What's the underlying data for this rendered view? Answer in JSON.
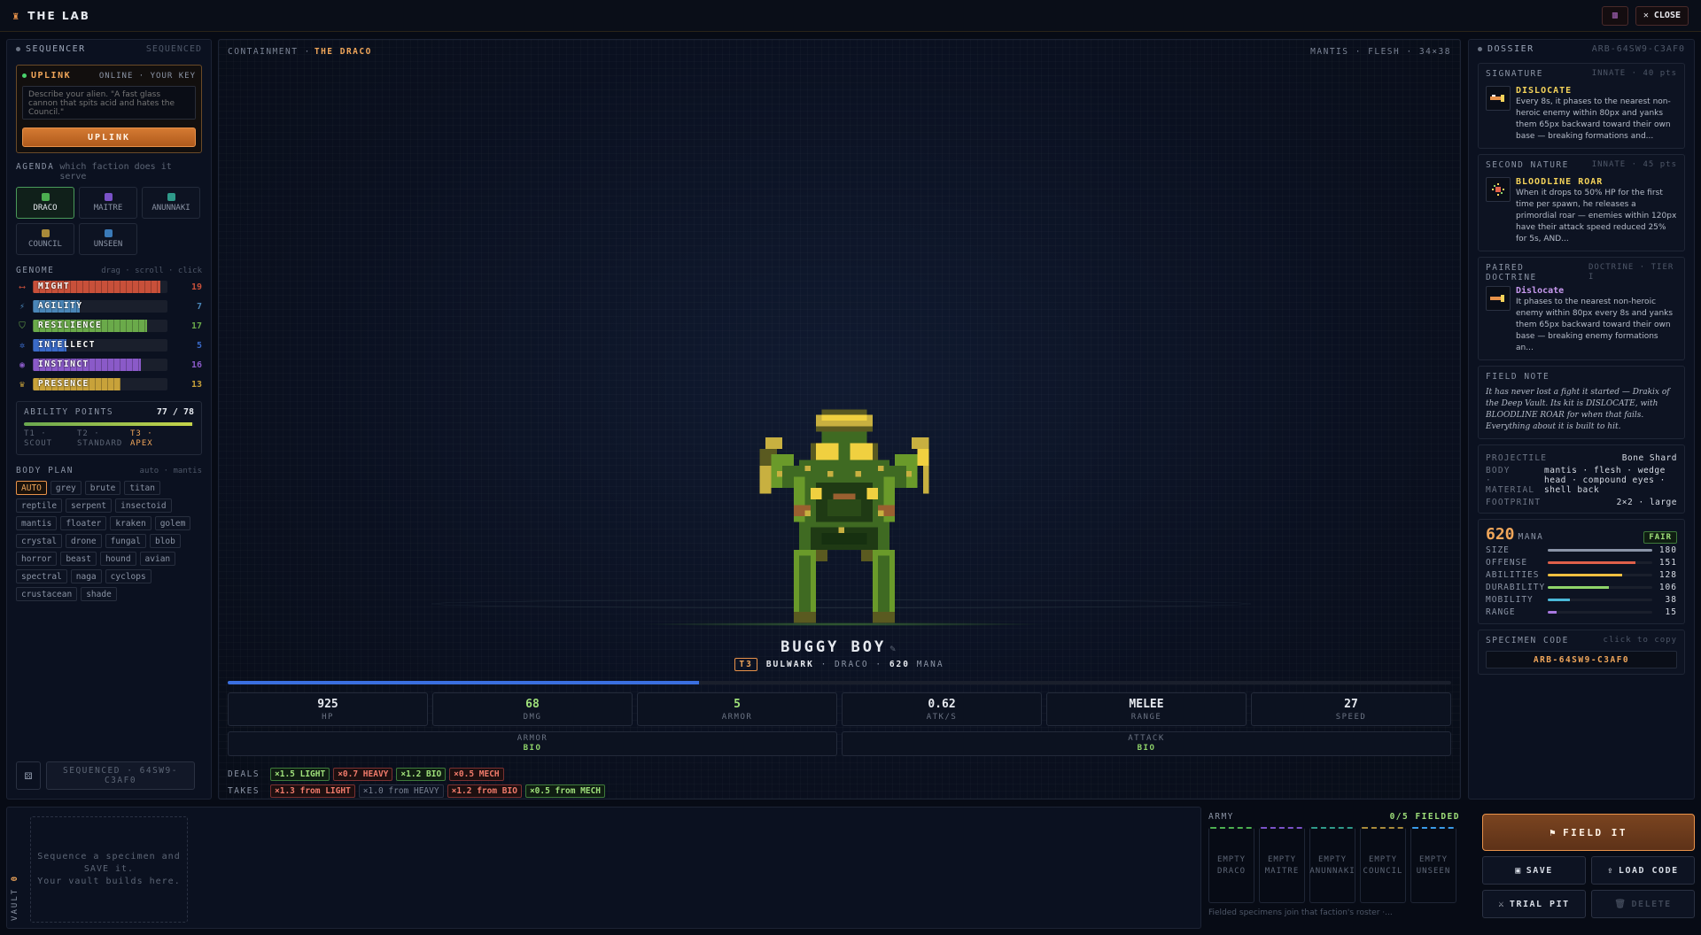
{
  "topbar": {
    "title": "THE LAB",
    "close_label": "✕ CLOSE"
  },
  "sequencer": {
    "title": "SEQUENCER",
    "status": "SEQUENCED",
    "uplink": {
      "title": "UPLINK",
      "status": "ONLINE · YOUR KEY",
      "placeholder": "Describe your alien. \"A fast glass cannon that spits acid and hates the Council.\"",
      "button": "UPLINK"
    },
    "agenda": {
      "label": "AGENDA",
      "hint": "which faction does it serve",
      "factions": [
        {
          "name": "DRACO",
          "color": "#4caf50",
          "selected": true
        },
        {
          "name": "MAITRE",
          "color": "#7a52c8"
        },
        {
          "name": "ANUNNAKI",
          "color": "#2f9a8a"
        },
        {
          "name": "COUNCIL",
          "color": "#a88a3a"
        },
        {
          "name": "UNSEEN",
          "color": "#3a7ab8"
        }
      ]
    },
    "genome": {
      "label": "GENOME",
      "hint": "drag · scroll · click",
      "stats": [
        {
          "name": "MIGHT",
          "value": 19,
          "max": 20,
          "color": "#c8503a",
          "icon": "⟷"
        },
        {
          "name": "AGILITY",
          "value": 7,
          "max": 20,
          "color": "#4a86b8",
          "icon": "⚡"
        },
        {
          "name": "RESILIENCE",
          "value": 17,
          "max": 20,
          "color": "#6aaa4a",
          "icon": "⛉"
        },
        {
          "name": "INTELLECT",
          "value": 5,
          "max": 20,
          "color": "#3a6ac8",
          "icon": "✲"
        },
        {
          "name": "INSTINCT",
          "value": 16,
          "max": 20,
          "color": "#8a5ac8",
          "icon": "◉"
        },
        {
          "name": "PRESENCE",
          "value": 13,
          "max": 20,
          "color": "#c8a23a",
          "icon": "♛"
        }
      ]
    },
    "ability_points": {
      "label": "ABILITY POINTS",
      "value": "77 / 78",
      "fraction": 0.987,
      "tiers": [
        {
          "a": "T1 ·",
          "b": "SCOUT"
        },
        {
          "a": "T2 ·",
          "b": "STANDARD"
        },
        {
          "a": "T3 ·",
          "b": "APEX",
          "active": true
        }
      ]
    },
    "body_plan": {
      "label": "BODY PLAN",
      "hint": "auto · mantis",
      "options": [
        "AUTO",
        "grey",
        "brute",
        "titan",
        "reptile",
        "serpent",
        "insectoid",
        "mantis",
        "floater",
        "kraken",
        "golem",
        "crystal",
        "drone",
        "fungal",
        "blob",
        "horror",
        "beast",
        "hound",
        "avian",
        "spectral",
        "naga",
        "cyclops",
        "crustacean",
        "shade"
      ]
    },
    "sequenced_label": "SEQUENCED · 64SW9-C3AF0"
  },
  "center": {
    "containment": "CONTAINMENT ·",
    "faction": "THE DRACO",
    "meta_right": "MANTIS · FLESH · 34×38",
    "name": "BUGGY BOY",
    "edit_icon": "✎",
    "tier": "T3",
    "class": "BULWARK",
    "faction_name": "DRACO",
    "mana": "620",
    "mana_unit": "MANA",
    "hp_fraction": 0.385,
    "stats": [
      {
        "value": "925",
        "label": "HP",
        "color": "#e6e9ef"
      },
      {
        "value": "68",
        "label": "DMG",
        "color": "#9fe07a"
      },
      {
        "value": "5",
        "label": "ARMOR",
        "color": "#9fe07a"
      },
      {
        "value": "0.62",
        "label": "ATK/S",
        "color": "#e6e9ef"
      },
      {
        "value": "MELEE",
        "label": "RANGE",
        "color": "#e6e9ef"
      },
      {
        "value": "27",
        "label": "SPEED",
        "color": "#e6e9ef"
      }
    ],
    "armor": {
      "label": "ARMOR",
      "value": "BIO"
    },
    "attack": {
      "label": "ATTACK",
      "value": "BIO"
    },
    "deals": {
      "label": "DEALS",
      "mods": [
        {
          "text": "×1.5 LIGHT",
          "kind": "good"
        },
        {
          "text": "×0.7 HEAVY",
          "kind": "bad"
        },
        {
          "text": "×1.2 BIO",
          "kind": "good"
        },
        {
          "text": "×0.5 MECH",
          "kind": "bad"
        }
      ]
    },
    "takes": {
      "label": "TAKES",
      "mods": [
        {
          "text": "×1.3 from LIGHT",
          "kind": "bad"
        },
        {
          "text": "×1.0 from HEAVY",
          "kind": "neu"
        },
        {
          "text": "×1.2 from BIO",
          "kind": "bad"
        },
        {
          "text": "×0.5 from MECH",
          "kind": "good"
        }
      ]
    }
  },
  "dossier": {
    "title": "DOSSIER",
    "code": "ARB-64SW9-C3AF0",
    "signature": {
      "label": "SIGNATURE",
      "meta": "INNATE · 40 pts",
      "name": "DISLOCATE",
      "desc": "Every 8s, it phases to the nearest non-heroic enemy within 80px and yanks them 65px backward toward their own base — breaking formations and..."
    },
    "second": {
      "label": "SECOND NATURE",
      "meta": "INNATE · 45 pts",
      "name": "BLOODLINE ROAR",
      "desc": "When it drops to 50% HP for the first time per spawn, he releases a primordial roar — enemies within 120px have their attack speed reduced 25% for 5s, AND..."
    },
    "doctrine": {
      "label": "PAIRED DOCTRINE",
      "meta": "DOCTRINE · TIER I",
      "name": "Dislocate",
      "desc": "It phases to the nearest non-heroic enemy within 80px every 8s and yanks them 65px backward toward their own base — breaking enemy formations an..."
    },
    "field_note": {
      "label": "FIELD NOTE",
      "text": "It has never lost a fight it started — Drakix of the Deep Vault. Its kit is DISLOCATE, with BLOODLINE ROAR for when that fails. Everything about it is built to hit."
    },
    "props": [
      {
        "k": "PROJECTILE",
        "v": "Bone Shard"
      },
      {
        "k": "BODY · MATERIAL",
        "v": "mantis · flesh · wedge head · compound eyes · shell back"
      },
      {
        "k": "FOOTPRINT",
        "v": "2×2 · large"
      }
    ],
    "mana": {
      "value": "620",
      "unit": "MANA",
      "rating": "FAIR",
      "rows": [
        {
          "k": "SIZE",
          "v": 180,
          "color": "#8a94a8"
        },
        {
          "k": "OFFENSE",
          "v": 151,
          "color": "#e0604a"
        },
        {
          "k": "ABILITIES",
          "v": 128,
          "color": "#f0c040"
        },
        {
          "k": "DURABILITY",
          "v": 106,
          "color": "#8fd46a"
        },
        {
          "k": "MOBILITY",
          "v": 38,
          "color": "#4ab8d8"
        },
        {
          "k": "RANGE",
          "v": 15,
          "color": "#a878e0"
        }
      ]
    },
    "specimen": {
      "label": "SPECIMEN CODE",
      "hint": "click to copy",
      "code": "ARB-64SW9-C3AF0"
    }
  },
  "vault": {
    "label": "VAULT",
    "count": "0",
    "empty": "Sequence a specimen and\nSAVE it.\nYour vault builds here."
  },
  "army": {
    "label": "ARMY",
    "fielded": "0/5 FIELDED",
    "slots": [
      {
        "a": "EMPTY",
        "b": "DRACO",
        "color": "#4caf50"
      },
      {
        "a": "EMPTY",
        "b": "MAITRE",
        "color": "#7a52c8"
      },
      {
        "a": "EMPTY",
        "b": "ANUNNAKI",
        "color": "#2f9a8a"
      },
      {
        "a": "EMPTY",
        "b": "COUNCIL",
        "color": "#a88a3a"
      },
      {
        "a": "EMPTY",
        "b": "UNSEEN",
        "color": "#3a9ae8"
      }
    ],
    "foot": "Fielded specimens join that faction's roster ·..."
  },
  "actions": {
    "field": "FIELD IT",
    "save": "SAVE",
    "load": "LOAD CODE",
    "trial": "TRIAL PIT",
    "delete": "DELETE"
  }
}
